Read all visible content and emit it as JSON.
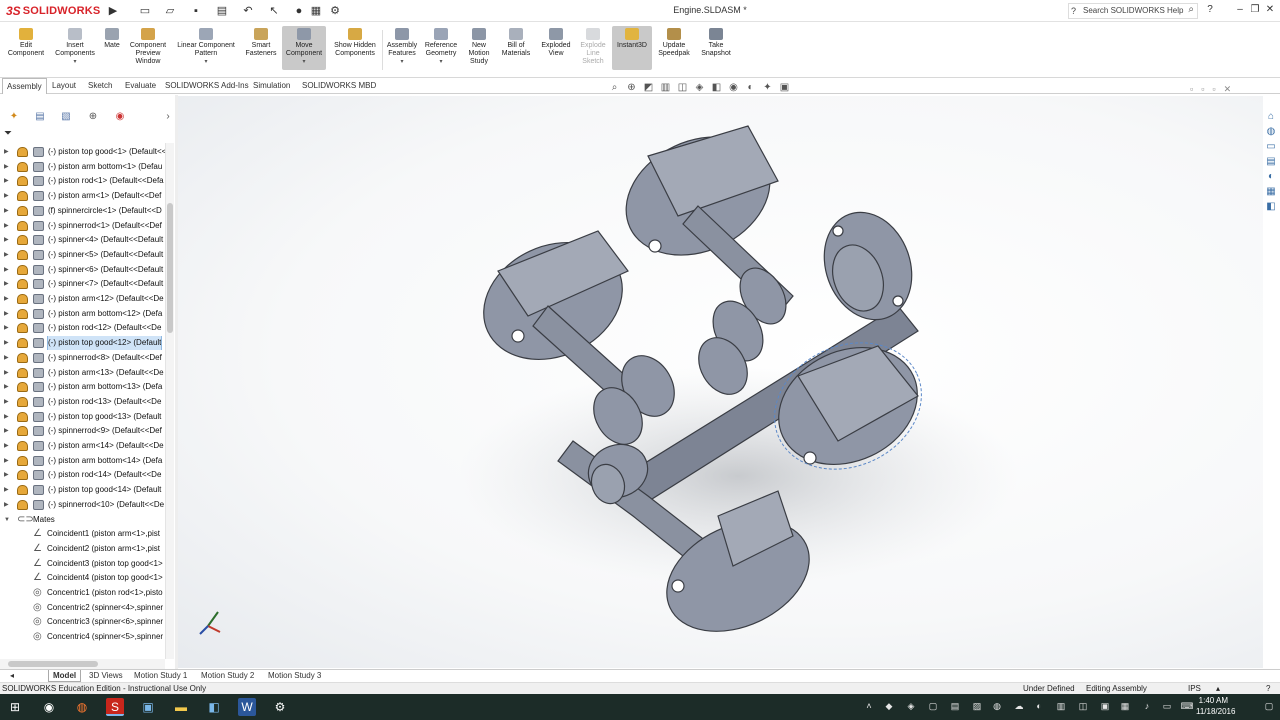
{
  "app": {
    "brand_ds": "3S",
    "brand_name": "SOLIDWORKS",
    "doc_title": "Engine.SLDASM *",
    "help_search": "Search SOLIDWORKS Help"
  },
  "toolbar": {
    "edit_component": "Edit Component",
    "insert_components": "Insert Components",
    "mate": "Mate",
    "component_preview": "Component Preview Window",
    "linear_pattern": "Linear Component Pattern",
    "smart_fasteners": "Smart Fasteners",
    "move_component": "Move Component",
    "show_hidden": "Show Hidden Components",
    "assembly_features": "Assembly Features",
    "reference_geometry": "Reference Geometry",
    "new_motion_study": "New Motion Study",
    "bill_of_materials": "Bill of Materials",
    "exploded_view": "Exploded View",
    "explode_line_sketch": "Explode Line Sketch",
    "instant3d": "Instant3D",
    "update_speedpak": "Update Speedpak",
    "take_snapshot": "Take Snapshot"
  },
  "tabs": [
    "Assembly",
    "Layout",
    "Sketch",
    "Evaluate",
    "SOLIDWORKS Add-Ins",
    "Simulation",
    "SOLIDWORKS MBD"
  ],
  "tree": {
    "components": [
      "(-) piston top good<1> (Default<<",
      "(-) piston arm bottom<1> (Defau",
      "(-) piston rod<1> (Default<<Defa",
      "(-) piston arm<1> (Default<<Def",
      "(f) spinnercircle<1> (Default<<D",
      "(-) spinnerrod<1> (Default<<Def",
      "(-) spinner<4> (Default<<Default",
      "(-) spinner<5> (Default<<Default",
      "(-) spinner<6> (Default<<Default",
      "(-) spinner<7> (Default<<Default",
      "(-) piston arm<12> (Default<<De",
      "(-) piston arm bottom<12> (Defa",
      "(-) piston rod<12> (Default<<De",
      "(-) piston top good<12> (Default",
      "(-) spinnerrod<8> (Default<<Def",
      "(-) piston arm<13> (Default<<De",
      "(-) piston arm bottom<13> (Defa",
      "(-) piston rod<13> (Default<<De",
      "(-) piston top good<13> (Default",
      "(-) spinnerrod<9> (Default<<Def",
      "(-) piston arm<14> (Default<<De",
      "(-) piston arm bottom<14> (Defa",
      "(-) piston rod<14> (Default<<De",
      "(-) piston top good<14> (Default",
      "(-) spinnerrod<10> (Default<<De"
    ],
    "mates_label": "Mates",
    "mates": [
      "Coincident1 (piston arm<1>,pist",
      "Coincident2 (piston arm<1>,pist",
      "Coincident3 (piston top good<1>",
      "Coincident4 (piston top good<1>",
      "Concentric1 (piston rod<1>,pisto",
      "Concentric2 (spinner<4>,spinner",
      "Concentric3 (spinner<6>,spinner",
      "Concentric4 (spinner<5>,spinner"
    ]
  },
  "bottom_tabs": [
    "Model",
    "3D Views",
    "Motion Study 1",
    "Motion Study 2",
    "Motion Study 3"
  ],
  "status": {
    "left": "SOLIDWORKS Education Edition - Instructional Use Only",
    "under_defined": "Under Defined",
    "editing": "Editing Assembly",
    "units": "IPS"
  },
  "taskbar": {
    "time": "1:40 AM",
    "date": "11/18/2016"
  },
  "colors": {
    "accent": "#d8232a",
    "part": "#8f96a6",
    "taskbar": "#1c2c28"
  }
}
